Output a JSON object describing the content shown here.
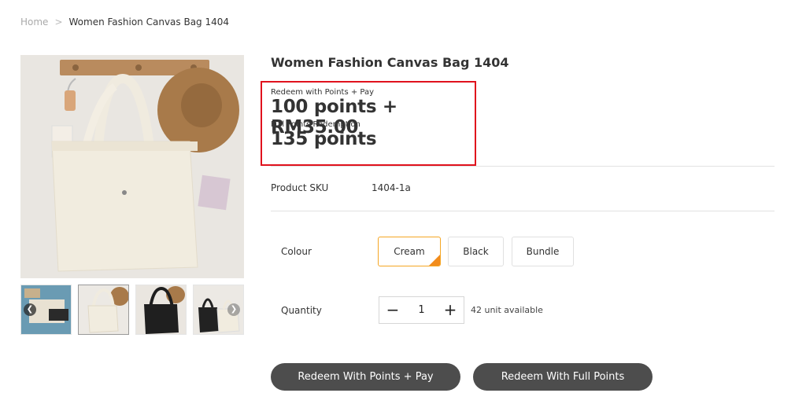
{
  "breadcrumb": {
    "home": "Home",
    "separator": ">",
    "current": "Women Fashion Canvas Bag 1404"
  },
  "product": {
    "title": "Women Fashion Canvas Bag 1404",
    "points_pay_label": "Redeem with Points + Pay",
    "points_pay_value": "100 points + RM35.00",
    "full_points_label": "Full Points Redemption",
    "full_points_value": "135 points",
    "sku_label": "Product SKU",
    "sku_value": "1404-1a"
  },
  "colour": {
    "label": "Colour",
    "options": [
      "Cream",
      "Black",
      "Bundle"
    ],
    "selected": "Cream"
  },
  "quantity": {
    "label": "Quantity",
    "minus": "−",
    "value": "1",
    "plus": "+",
    "available": "42 unit available"
  },
  "actions": {
    "points_pay": "Redeem With Points + Pay",
    "full_points": "Redeem With Full Points"
  },
  "gallery": {
    "thumbnails": 4,
    "active_index": 1,
    "prev_icon": "chevron-left-icon",
    "next_icon": "chevron-right-icon"
  },
  "colors": {
    "highlight_border": "#e0121d",
    "selected_option": "#f28c1c",
    "button_bg": "#4d4d4d"
  }
}
